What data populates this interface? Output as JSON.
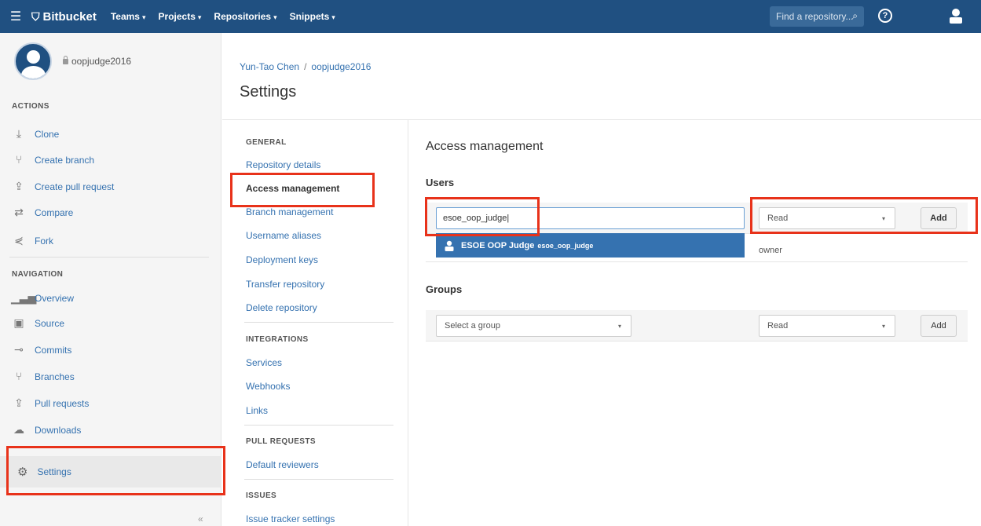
{
  "topbar": {
    "brand": "Bitbucket",
    "nav": [
      {
        "label": "Teams"
      },
      {
        "label": "Projects"
      },
      {
        "label": "Repositories"
      },
      {
        "label": "Snippets"
      }
    ],
    "search_placeholder": "Find a repository...",
    "help_glyph": "?"
  },
  "sidebar": {
    "repo_name": "oopjudge2016",
    "actions_heading": "ACTIONS",
    "actions": [
      {
        "label": "Clone",
        "icon": "clone-icon"
      },
      {
        "label": "Create branch",
        "icon": "branch-icon"
      },
      {
        "label": "Create pull request",
        "icon": "pull-request-icon"
      },
      {
        "label": "Compare",
        "icon": "compare-icon"
      },
      {
        "label": "Fork",
        "icon": "fork-icon"
      }
    ],
    "navigation_heading": "NAVIGATION",
    "navigation": [
      {
        "label": "Overview",
        "icon": "overview-icon"
      },
      {
        "label": "Source",
        "icon": "source-icon"
      },
      {
        "label": "Commits",
        "icon": "commits-icon"
      },
      {
        "label": "Branches",
        "icon": "branches-icon"
      },
      {
        "label": "Pull requests",
        "icon": "pull-requests-icon"
      },
      {
        "label": "Downloads",
        "icon": "downloads-icon"
      }
    ],
    "settings_label": "Settings",
    "collapse_glyph": "«"
  },
  "breadcrumb": {
    "owner": "Yun-Tao Chen",
    "separator": "/",
    "repo": "oopjudge2016"
  },
  "page_title": "Settings",
  "settings_nav": {
    "general_heading": "GENERAL",
    "general": [
      "Repository details",
      "Access management",
      "Branch management",
      "Username aliases",
      "Deployment keys",
      "Transfer repository",
      "Delete repository"
    ],
    "integrations_heading": "INTEGRATIONS",
    "integrations": [
      "Services",
      "Webhooks",
      "Links"
    ],
    "pull_requests_heading": "PULL REQUESTS",
    "pull_requests": [
      "Default reviewers"
    ],
    "issues_heading": "ISSUES",
    "issues": [
      "Issue tracker settings"
    ]
  },
  "panel": {
    "title": "Access management",
    "users_heading": "Users",
    "user_input_value": "esoe_oop_judge",
    "user_permission": "Read",
    "user_add_label": "Add",
    "suggestion_display_name": "ESOE OOP Judge",
    "suggestion_username": "esoe_oop_judge",
    "owner_label": "owner",
    "groups_heading": "Groups",
    "group_select_placeholder": "Select a group",
    "group_permission": "Read",
    "group_add_label": "Add"
  },
  "colors": {
    "header": "#205081",
    "link": "#3572b0",
    "highlight": "#e8321a"
  }
}
